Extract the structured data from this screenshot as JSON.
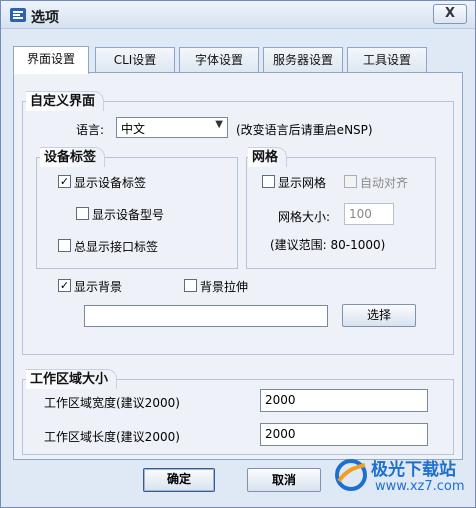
{
  "window": {
    "title": "选项",
    "close_label": "X"
  },
  "tabs": [
    {
      "label": "界面设置"
    },
    {
      "label": "CLI设置"
    },
    {
      "label": "字体设置"
    },
    {
      "label": "服务器设置"
    },
    {
      "label": "工具设置"
    }
  ],
  "custom_ui": {
    "title": "自定义界面",
    "language_label": "语言:",
    "language_value": "中文",
    "language_hint": "(改变语言后请重启eNSP)",
    "device_tag": {
      "title": "设备标签",
      "show_device_tag": {
        "label": "显示设备标签",
        "checked": true
      },
      "show_device_model": {
        "label": "显示设备型号",
        "checked": false
      },
      "always_show_port": {
        "label": "总显示接口标签",
        "checked": false
      }
    },
    "grid": {
      "title": "网格",
      "show_grid": {
        "label": "显示网格",
        "checked": false
      },
      "auto_align": {
        "label": "自动对齐",
        "checked": false
      },
      "size_label": "网格大小:",
      "size_value": "100",
      "range_hint": "(建议范围: 80-1000)"
    },
    "show_background": {
      "label": "显示背景",
      "checked": true
    },
    "stretch_background": {
      "label": "背景拉伸",
      "checked": false
    },
    "background_path": "",
    "choose_label": "选择"
  },
  "workspace": {
    "title": "工作区域大小",
    "width_label": "工作区域宽度(建议2000)",
    "width_value": "2000",
    "length_label": "工作区域长度(建议2000)",
    "length_value": "2000"
  },
  "footer": {
    "ok_label": "确定",
    "cancel_label": "取消"
  },
  "watermark": {
    "name": "极光下载站",
    "url": "www.xz7.com"
  },
  "colors": {
    "accent": "#1d6fd1",
    "window_bg": "#dfe9f5",
    "panel_bg": "#eef2f8"
  }
}
